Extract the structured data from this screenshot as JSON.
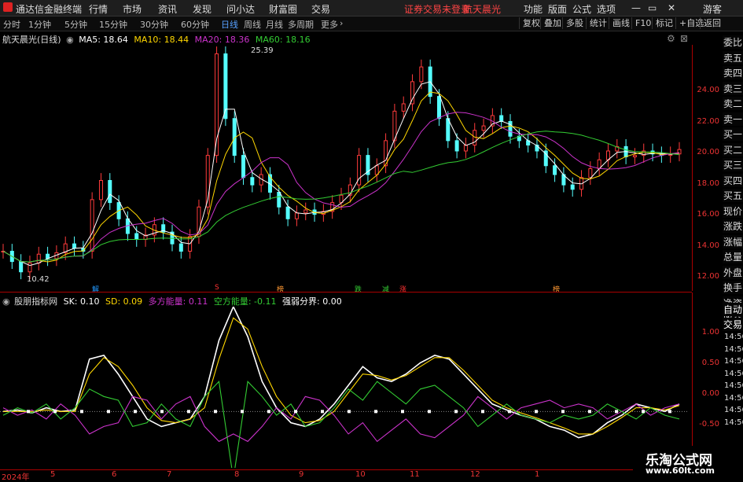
{
  "menubar": {
    "app_title": "通达信金融终端",
    "items": [
      "行情",
      "市场",
      "资讯",
      "发现",
      "问小达",
      "财富圈",
      "交易"
    ],
    "status": "证券交易未登录",
    "stock_name": "航天晨光",
    "right_items": [
      "功能",
      "版面",
      "公式",
      "选项"
    ],
    "guest": "游客"
  },
  "toolbar": {
    "periods": [
      "分时",
      "1分钟",
      "5分钟",
      "15分钟",
      "30分钟",
      "60分钟",
      "日线",
      "周线",
      "月线",
      "多周期",
      "更多"
    ],
    "active_period": "日线",
    "right_buttons": [
      "复权",
      "叠加",
      "多股",
      "统计",
      "画线",
      "F10",
      "标记",
      "+自选",
      "返回"
    ]
  },
  "main_legend": {
    "title": "航天晨光(日线)",
    "ma": [
      {
        "label": "MA5: 18.64",
        "color": "#ffffff"
      },
      {
        "label": "MA10: 18.44",
        "color": "#ffd700"
      },
      {
        "label": "MA20: 18.36",
        "color": "#cc33cc"
      },
      {
        "label": "MA60: 18.16",
        "color": "#33cc33"
      }
    ]
  },
  "sub_legend": {
    "title": "股朋指标网",
    "items": [
      {
        "label": "SK: 0.10",
        "color": "#ffffff"
      },
      {
        "label": "SD: 0.09",
        "color": "#ffd700"
      },
      {
        "label": "多方能量: 0.11",
        "color": "#cc33cc"
      },
      {
        "label": "空方能量: -0.11",
        "color": "#33cc33"
      },
      {
        "label": "强弱分界: 0.00",
        "color": "#ffffff"
      }
    ]
  },
  "price_axis": [
    "24.00",
    "22.00",
    "20.00",
    "18.00",
    "16.00",
    "14.00",
    "12.00"
  ],
  "indicator_axis": [
    "1.00",
    "0.50",
    "0.00",
    "-0.50"
  ],
  "price_annotations": {
    "high": "25.39",
    "low": "10.42"
  },
  "date_axis": [
    "2024年",
    "5",
    "6",
    "7",
    "8",
    "9",
    "10",
    "11",
    "12",
    "1"
  ],
  "markers": [
    {
      "text": "解",
      "color": "#2299ff"
    },
    {
      "text": "S",
      "color": "#ff3333"
    },
    {
      "text": "榜",
      "color": "#ff9933"
    },
    {
      "text": "跌",
      "color": "#33cc33"
    },
    {
      "text": "减",
      "color": "#33cc33"
    },
    {
      "text": "涨",
      "color": "#ff3333"
    },
    {
      "text": "榜",
      "color": "#ff9933"
    }
  ],
  "side_panel": [
    "委比",
    "卖五",
    "卖四",
    "卖三",
    "卖二",
    "卖一",
    "买一",
    "买二",
    "买三",
    "买四",
    "买五",
    "现价",
    "涨跌",
    "涨幅",
    "总量",
    "外盘",
    "换手",
    "净资",
    "收益",
    "自动",
    "交易"
  ],
  "side_times": [
    "14:56",
    "14:56",
    "14:56",
    "14:56",
    "14:56",
    "14:56",
    "14:56",
    "14:56"
  ],
  "watermark": {
    "line1": "乐淘公式网",
    "line2": "www.60lt.com"
  },
  "chart_data": {
    "type": "line",
    "title": "航天晨光(日线)",
    "price_range": [
      10.0,
      26.0
    ],
    "price_points": [
      12.0,
      11.3,
      10.6,
      11.2,
      11.8,
      11.5,
      11.9,
      12.5,
      12.2,
      12.0,
      15.5,
      16.8,
      15.3,
      14.2,
      13.2,
      12.8,
      13.1,
      13.8,
      13.3,
      12.5,
      12.0,
      13.0,
      15.0,
      18.5,
      25.39,
      21.0,
      18.5,
      17.0,
      16.5,
      17.2,
      16.0,
      15.0,
      14.2,
      14.6,
      14.8,
      14.5,
      14.7,
      15.3,
      15.8,
      16.5,
      18.5,
      17.2,
      17.8,
      19.5,
      21.5,
      22.0,
      23.5,
      24.5,
      22.5,
      21.0,
      19.5,
      18.8,
      19.2,
      20.2,
      20.5,
      21.2,
      20.8,
      19.8,
      19.5,
      19.2,
      18.8,
      17.8,
      17.2,
      16.5,
      16.2,
      17.0,
      17.6,
      18.2,
      18.8,
      19.1,
      18.4,
      18.5,
      18.8,
      18.6,
      18.5,
      18.6,
      18.9
    ],
    "indicator_range": [
      -0.7,
      1.4
    ],
    "series": [
      {
        "name": "SK",
        "color": "#ffffff",
        "values": [
          0.0,
          0.02,
          -0.02,
          0.05,
          0.0,
          0.02,
          0.7,
          0.75,
          0.5,
          0.2,
          -0.1,
          -0.2,
          -0.15,
          -0.1,
          0.2,
          0.95,
          1.4,
          1.0,
          0.4,
          0.05,
          -0.15,
          -0.2,
          -0.1,
          0.1,
          0.35,
          0.6,
          0.45,
          0.4,
          0.5,
          0.65,
          0.75,
          0.7,
          0.5,
          0.3,
          0.1,
          0.02,
          -0.05,
          -0.1,
          -0.2,
          -0.25,
          -0.35,
          -0.3,
          -0.15,
          -0.05,
          0.1,
          0.05,
          0.0,
          0.1
        ]
      },
      {
        "name": "SD",
        "color": "#ffd700",
        "values": [
          0.0,
          0.0,
          0.0,
          0.02,
          0.0,
          0.0,
          0.5,
          0.72,
          0.6,
          0.35,
          0.05,
          -0.12,
          -0.15,
          -0.1,
          0.05,
          0.7,
          1.25,
          1.1,
          0.6,
          0.2,
          -0.05,
          -0.15,
          -0.12,
          0.0,
          0.25,
          0.5,
          0.48,
          0.42,
          0.48,
          0.6,
          0.72,
          0.72,
          0.55,
          0.35,
          0.15,
          0.05,
          -0.02,
          -0.08,
          -0.15,
          -0.22,
          -0.3,
          -0.3,
          -0.2,
          -0.08,
          0.05,
          0.05,
          0.02,
          0.08
        ]
      },
      {
        "name": "多方能量",
        "color": "#cc33cc",
        "values": [
          0.05,
          -0.05,
          0.02,
          -0.1,
          0.1,
          -0.05,
          -0.3,
          -0.2,
          -0.15,
          0.2,
          0.15,
          -0.1,
          0.1,
          0.2,
          -0.2,
          -0.4,
          -0.3,
          -0.4,
          -0.2,
          0.05,
          -0.1,
          0.2,
          0.15,
          -0.05,
          -0.3,
          -0.15,
          -0.4,
          -0.25,
          -0.1,
          -0.3,
          -0.35,
          -0.2,
          -0.05,
          0.2,
          0.05,
          -0.1,
          0.05,
          0.1,
          0.15,
          0.05,
          0.1,
          0.05,
          -0.1,
          0.0,
          0.1,
          -0.05,
          0.05,
          0.1
        ]
      },
      {
        "name": "空方能量",
        "color": "#33cc33",
        "values": [
          -0.05,
          0.05,
          -0.02,
          0.1,
          -0.1,
          0.05,
          0.3,
          0.2,
          0.15,
          -0.2,
          -0.15,
          0.1,
          -0.1,
          -0.2,
          0.2,
          0.4,
          -0.9,
          0.4,
          0.2,
          -0.05,
          0.1,
          -0.2,
          -0.15,
          0.05,
          0.3,
          0.15,
          0.4,
          0.25,
          0.1,
          0.3,
          0.35,
          0.2,
          0.05,
          -0.2,
          -0.05,
          0.1,
          -0.05,
          -0.1,
          -0.15,
          -0.05,
          -0.1,
          -0.05,
          0.1,
          0.0,
          -0.1,
          0.05,
          -0.05,
          -0.1
        ]
      }
    ]
  }
}
